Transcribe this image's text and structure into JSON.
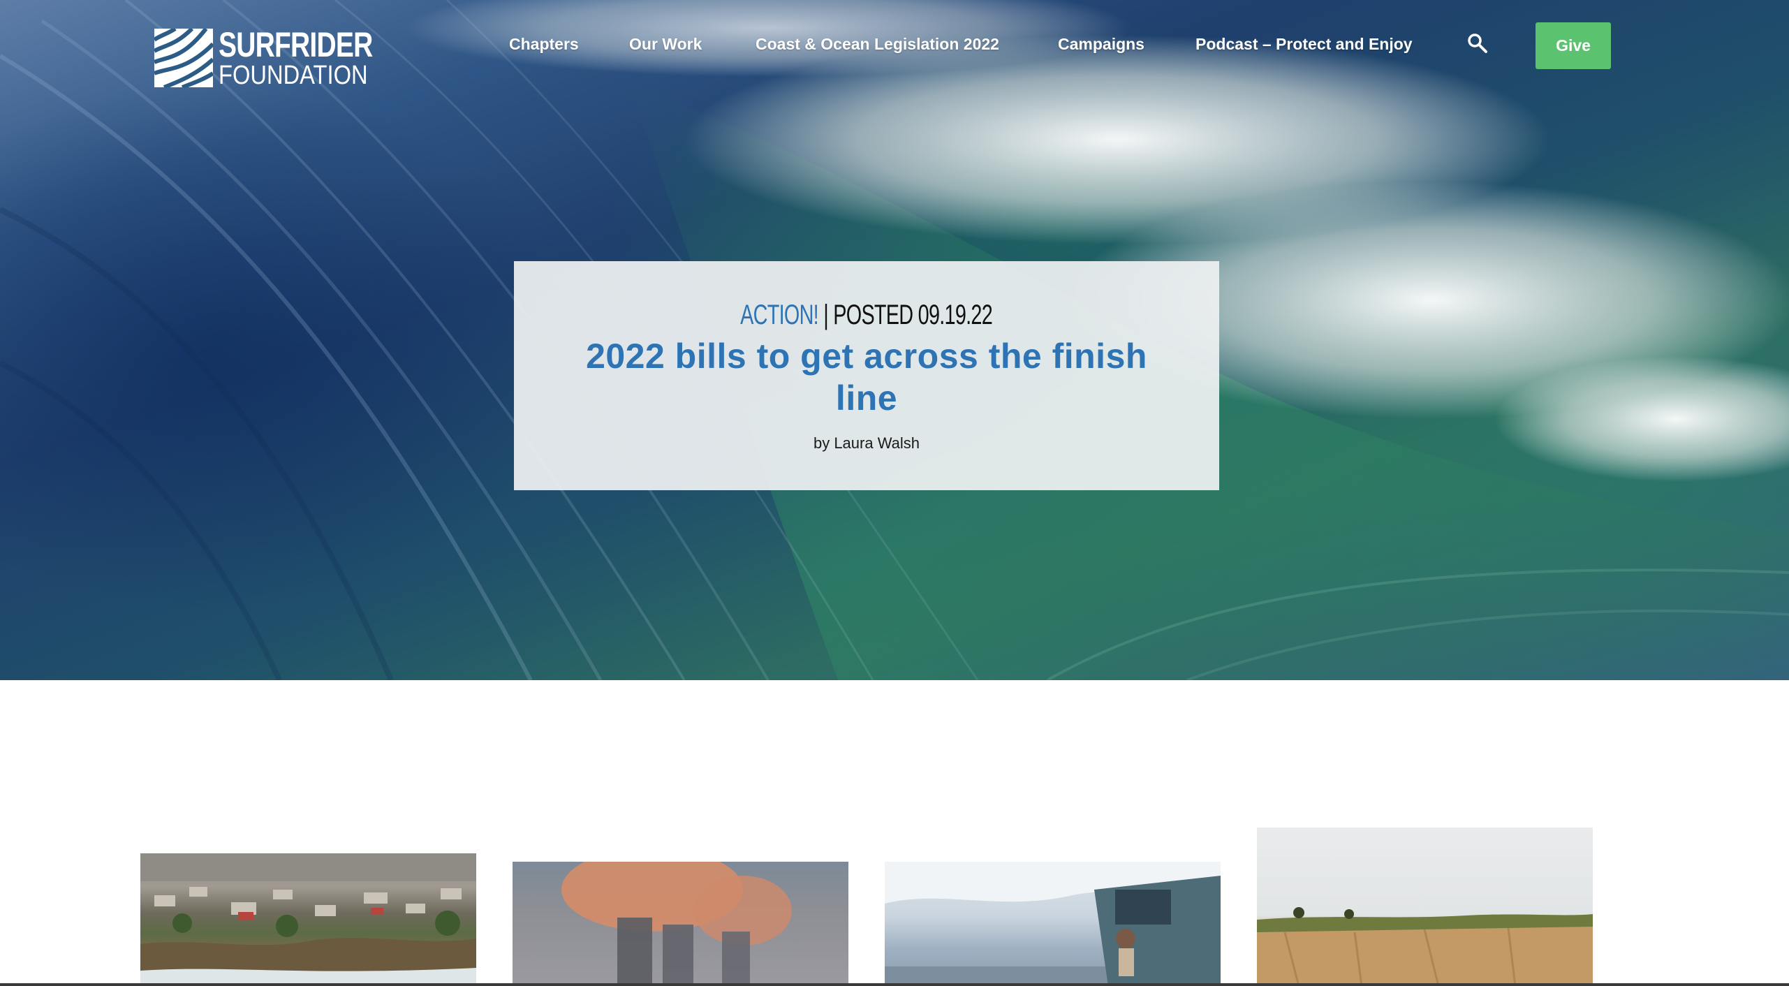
{
  "brand": {
    "name_line1": "SURFRIDER",
    "name_line2": "FOUNDATION"
  },
  "nav": {
    "items": [
      {
        "label": "Chapters"
      },
      {
        "label": "Our Work"
      },
      {
        "label": "Coast & Ocean Legislation 2022"
      },
      {
        "label": "Campaigns"
      },
      {
        "label": "Podcast – Protect and Enjoy"
      }
    ],
    "search_icon": "search-icon",
    "give_label": "Give"
  },
  "article": {
    "category": "ACTION!",
    "separator": "|",
    "posted": "POSTED 09.19.22",
    "title": "2022 bills to get across the finish line",
    "byline": "by Laura Walsh"
  },
  "related": {
    "thumbnails": [
      "coastal-homes-cliff-photo",
      "smokestacks-photo",
      "van-beach-photo",
      "bluff-cliff-photo"
    ]
  },
  "colors": {
    "accent_blue": "#2e74b5",
    "give_green": "#5bc36f",
    "card_bg": "#eceff0"
  }
}
